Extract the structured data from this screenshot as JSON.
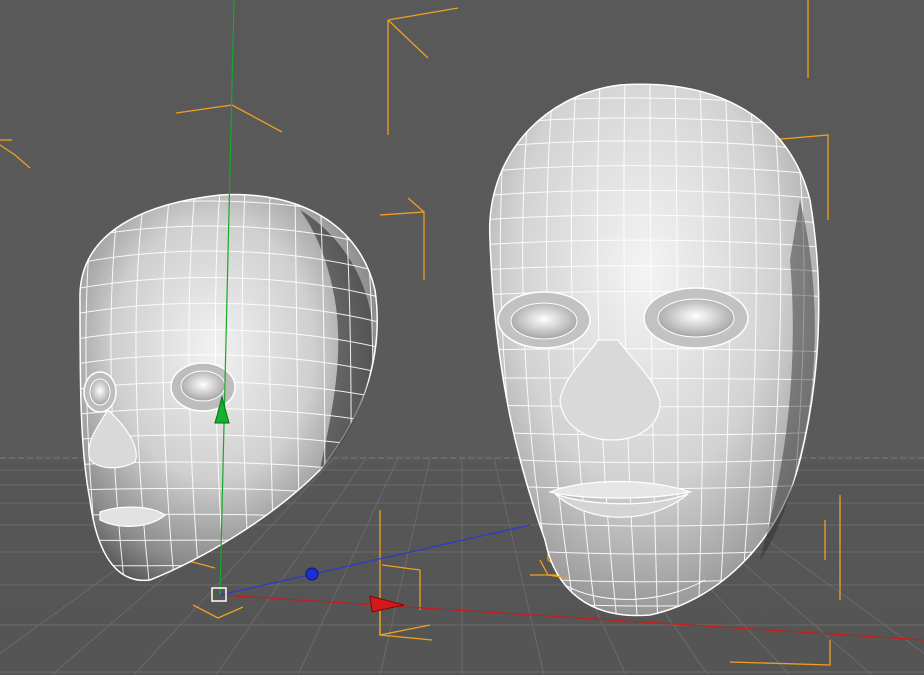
{
  "viewport": {
    "background_color": "#5a5a5a",
    "grid_color": "#6a6a6a",
    "horizon_color": "#7a7a7a"
  },
  "colors": {
    "mesh_wire": "#ffffff",
    "selection_bracket": "#f0a020",
    "axis_x": "#cc1a1a",
    "axis_y": "#18a828",
    "axis_z": "#2a3ad0"
  },
  "objects": [
    {
      "name": "head-left",
      "kind": "polygon-head-mesh",
      "view": "three-quarter",
      "selected": true
    },
    {
      "name": "head-right",
      "kind": "polygon-head-mesh",
      "view": "front",
      "selected": true
    }
  ],
  "gizmo": {
    "type": "move-manipulator",
    "axes": [
      "x-axis-handle",
      "y-axis-handle",
      "z-axis-handle"
    ]
  }
}
